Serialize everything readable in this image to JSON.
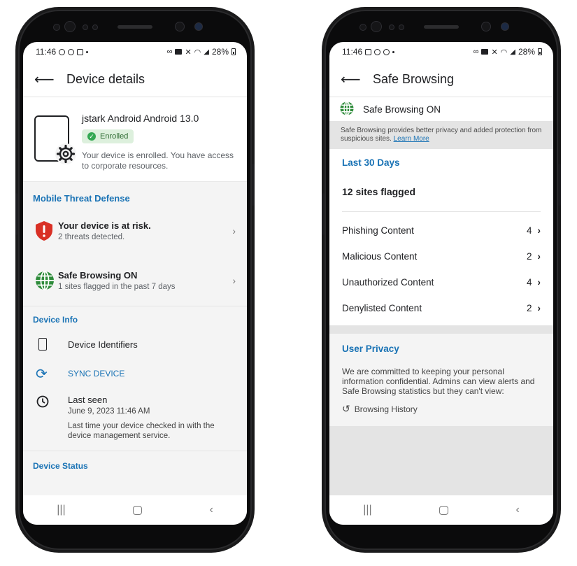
{
  "status_bar": {
    "left": {
      "time": "11:46"
    },
    "right": {
      "battery": "28%"
    }
  },
  "left_screen": {
    "app_title": "Device details",
    "device": {
      "name": "jstark Android Android 13.0",
      "badge": "Enrolled",
      "description": "Your device is enrolled. You have access to corporate resources."
    },
    "mtd": {
      "heading": "Mobile Threat Defense",
      "risk": {
        "title": "Your device is at risk.",
        "subtitle": "2 threats detected."
      },
      "safe_browsing": {
        "title": "Safe Browsing ON",
        "subtitle": "1 sites flagged in the past 7 days"
      }
    },
    "device_info": {
      "heading": "Device Info",
      "identifiers": "Device Identifiers",
      "sync": "SYNC DEVICE",
      "last_seen": {
        "title": "Last seen",
        "date": "June 9, 2023 11:46 AM",
        "note": "Last time your device checked in with the device management service."
      }
    },
    "device_status": {
      "heading": "Device Status"
    }
  },
  "right_screen": {
    "app_title": "Safe Browsing",
    "status": "Safe Browsing ON",
    "banner": {
      "text": "Safe Browsing provides better privacy and added protection from suspicious sites.",
      "link": "Learn More"
    },
    "period": "Last 30 Days",
    "flagged": "12 sites flagged",
    "categories": [
      {
        "label": "Phishing Content",
        "count": "4"
      },
      {
        "label": "Malicious Content",
        "count": "2"
      },
      {
        "label": "Unauthorized Content",
        "count": "4"
      },
      {
        "label": "Denylisted Content",
        "count": "2"
      }
    ],
    "privacy": {
      "heading": "User Privacy",
      "text": "We are committed to keeping your personal information confidential. Admins can view alerts and Safe Browsing statistics but they can't view:",
      "item": "Browsing History"
    }
  },
  "colors": {
    "accent": "#1a73b5",
    "risk_red": "#d93025",
    "enrolled_green": "#34a853",
    "globe_green": "#2e8b3a"
  }
}
